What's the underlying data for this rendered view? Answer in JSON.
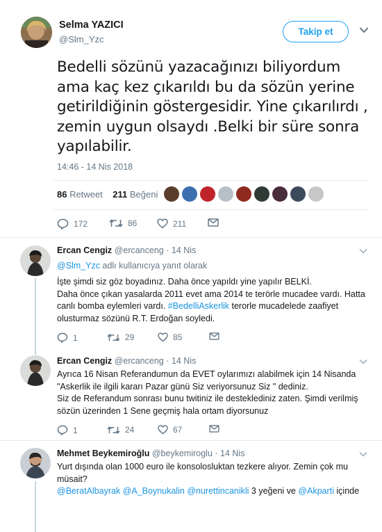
{
  "main_tweet": {
    "author_name": "Selma YAZICI",
    "author_handle": "@Slm_Yzc",
    "follow_label": "Takip et",
    "text": "Bedelli sözünü yazacağınızı biliyordum ama kaç kez çıkarıldı bu da sözün yerine getirildiğinin göstergesidir. Yine çıkarılırdı , zemin uygun olsaydı .Belki bir süre sonra yapılabilir.",
    "timestamp": "14:46 - 14 Nis 2018",
    "retweet_count": "86",
    "retweet_label": "Retweet",
    "like_count": "211",
    "like_label": "Beğeni",
    "actions": {
      "replies": "172",
      "retweets": "86",
      "likes": "211"
    }
  },
  "likers": [
    {
      "color": "#5a3d2b"
    },
    {
      "color": "#3d6fb0"
    },
    {
      "color": "#c0242b"
    },
    {
      "color": "#b7c0c8"
    },
    {
      "color": "#8e2a1f"
    },
    {
      "color": "#2f3b34"
    },
    {
      "color": "#4a2d3a"
    },
    {
      "color": "#3c4a5c"
    },
    {
      "color": "#c7c7c7"
    }
  ],
  "replies": [
    {
      "name": "Ercan Cengiz",
      "handle": "@ercanceng",
      "sep": "·",
      "date": "14 Nis",
      "replying_handle": "@Slm_Yzc",
      "replying_suffix": " adlı kullanıcıya yanıt olarak",
      "lines": [
        "İşte şimdi siz göz boyadınız. Daha önce yapıldı yine yapılır BELKİ.",
        "Daha önce çıkan yasalarda 2011 evet ama 2014 te terörle mucadee vardı. Hatta canlı bomba eylemleri vardı. "
      ],
      "hashtag": "#BedelliAskerlik",
      "after_hashtag": " terorle mucadelede zaafiyet olusturmaz sözünü R.T. Erdoğan soyledi.",
      "actions": {
        "replies": "1",
        "retweets": "29",
        "likes": "85"
      }
    },
    {
      "name": "Ercan Cengiz",
      "handle": "@ercanceng",
      "sep": "·",
      "date": "14 Nis",
      "lines": [
        "Ayrıca 16 Nisan Referandumun da EVET oylarımızı alabilmek için 14 Nisanda \"Askerlik ile ilgili kararı Pazar günü Siz veriyorsunuz Siz \"  dediniz.",
        "Siz de Referandum sonrası  bunu twitiniz ile desteklediniz zaten. Şimdi verilmiş sözün üzerinden 1 Sene geçmiş hala ortam diyorsunuz"
      ],
      "actions": {
        "replies": "1",
        "retweets": "24",
        "likes": "67"
      }
    },
    {
      "name": "Mehmet Beykemiroğlu",
      "handle": "@beykemiroglu",
      "sep": "·",
      "date": "14 Nis",
      "lines": [
        "Yurt dışında olan 1000 euro ile konsolosluktan tezkere alıyor. Zemin çok mu müsait?"
      ],
      "mentions": [
        "@BeratAlbayrak",
        "@A_Boynukalin",
        "@nurettincanikli"
      ],
      "mentions_tail": " 3 yeğeni ve ",
      "mention_last": "@Akparti",
      "mentions_end": " içinde"
    }
  ]
}
